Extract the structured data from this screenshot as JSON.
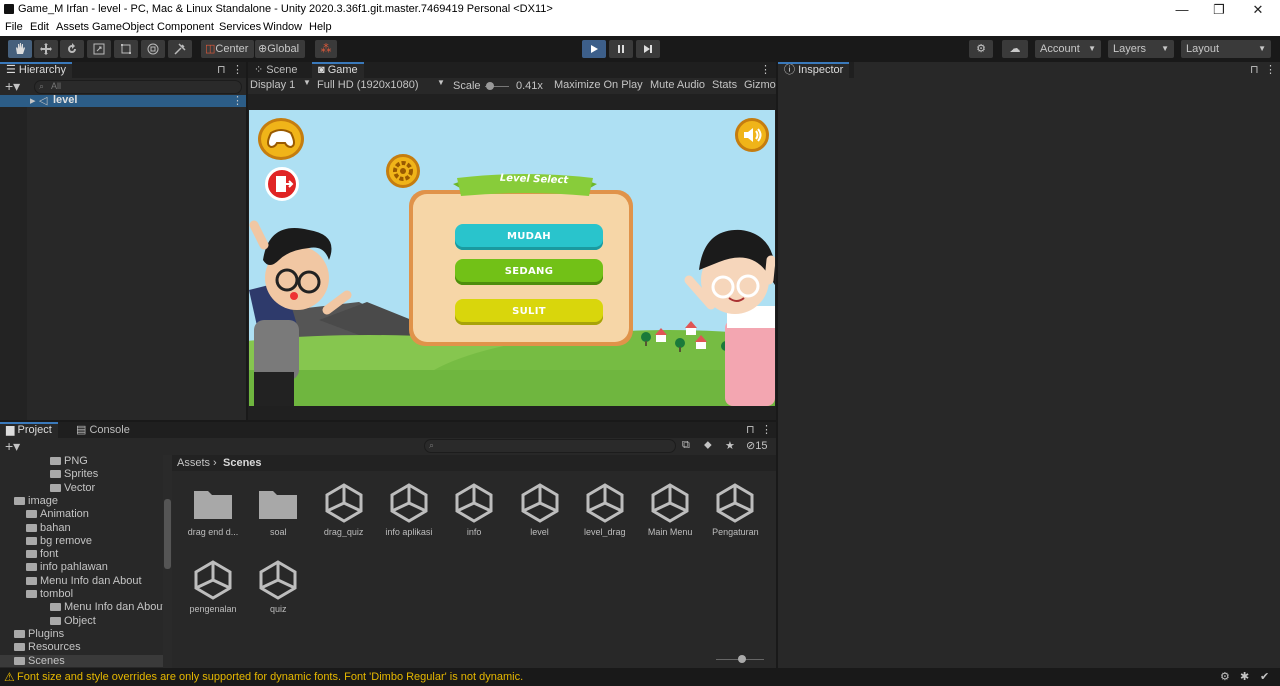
{
  "window": {
    "title": "Game_M Irfan - level - PC, Mac & Linux Standalone - Unity 2020.3.36f1.git.master.7469419 Personal <DX11>",
    "minimize": "—",
    "maximize": "❐",
    "close": "✕"
  },
  "menu": [
    "File",
    "Edit",
    "Assets",
    "GameObject",
    "Component",
    "Services",
    "Window",
    "Help"
  ],
  "toolbar": {
    "pivot_label": "Center",
    "space_label": "Global",
    "account_label": "Account",
    "layers_label": "Layers",
    "layout_label": "Layout"
  },
  "hierarchy": {
    "tab_label": "Hierarchy",
    "search_placeholder": "All",
    "scene_name": "level"
  },
  "gameview": {
    "tabs": [
      "Scene",
      "Game"
    ],
    "display": "Display 1",
    "resolution": "Full HD (1920x1080)",
    "scale_label": "Scale",
    "scale_value": "0.41x",
    "maximize_on_play": "Maximize On Play",
    "mute_audio": "Mute Audio",
    "stats": "Stats",
    "gizmos": "Gizmo",
    "game": {
      "banner_text": "Level Select",
      "buttons": [
        "MUDAH",
        "SEDANG",
        "SULIT"
      ]
    }
  },
  "inspector": {
    "tab_label": "Inspector"
  },
  "project": {
    "tabs": [
      "Project",
      "Console"
    ],
    "breadcrumb": [
      "Assets",
      "Scenes"
    ],
    "hidden_count": "15",
    "tree": [
      {
        "label": "PNG",
        "depth": 4
      },
      {
        "label": "Sprites",
        "depth": 4
      },
      {
        "label": "Vector",
        "depth": 4
      },
      {
        "label": "image",
        "depth": 1
      },
      {
        "label": "Animation",
        "depth": 2
      },
      {
        "label": "bahan",
        "depth": 2
      },
      {
        "label": "bg remove",
        "depth": 2
      },
      {
        "label": "font",
        "depth": 2
      },
      {
        "label": "info pahlawan",
        "depth": 2
      },
      {
        "label": "Menu Info dan About",
        "depth": 2
      },
      {
        "label": "tombol",
        "depth": 2
      },
      {
        "label": "Menu Info dan About",
        "depth": 3
      },
      {
        "label": "Object",
        "depth": 3
      },
      {
        "label": "Plugins",
        "depth": 1
      },
      {
        "label": "Resources",
        "depth": 1
      },
      {
        "label": "Scenes",
        "depth": 1
      }
    ],
    "assets": [
      {
        "name": "drag end d...",
        "type": "folder"
      },
      {
        "name": "soal",
        "type": "folder"
      },
      {
        "name": "drag_quiz",
        "type": "scene"
      },
      {
        "name": "info aplikasi",
        "type": "scene"
      },
      {
        "name": "info",
        "type": "scene"
      },
      {
        "name": "level",
        "type": "scene"
      },
      {
        "name": "level_drag",
        "type": "scene"
      },
      {
        "name": "Main Menu",
        "type": "scene"
      },
      {
        "name": "Pengaturan",
        "type": "scene"
      },
      {
        "name": "pengenalan",
        "type": "scene"
      },
      {
        "name": "quiz",
        "type": "scene"
      }
    ]
  },
  "statusbar": {
    "message": "Font size and style overrides are only supported for dynamic fonts. Font 'Dimbo Regular' is not dynamic."
  },
  "colors": {
    "editor_bg": "#191919",
    "panel_bg": "#282828",
    "accent": "#3a79bb",
    "sky": "#aee0f3",
    "grass": "#6fb63f",
    "mudah": "#29c4cc",
    "sedang": "#72c117",
    "sulit": "#d9d60c",
    "warning": "#e6b800"
  }
}
